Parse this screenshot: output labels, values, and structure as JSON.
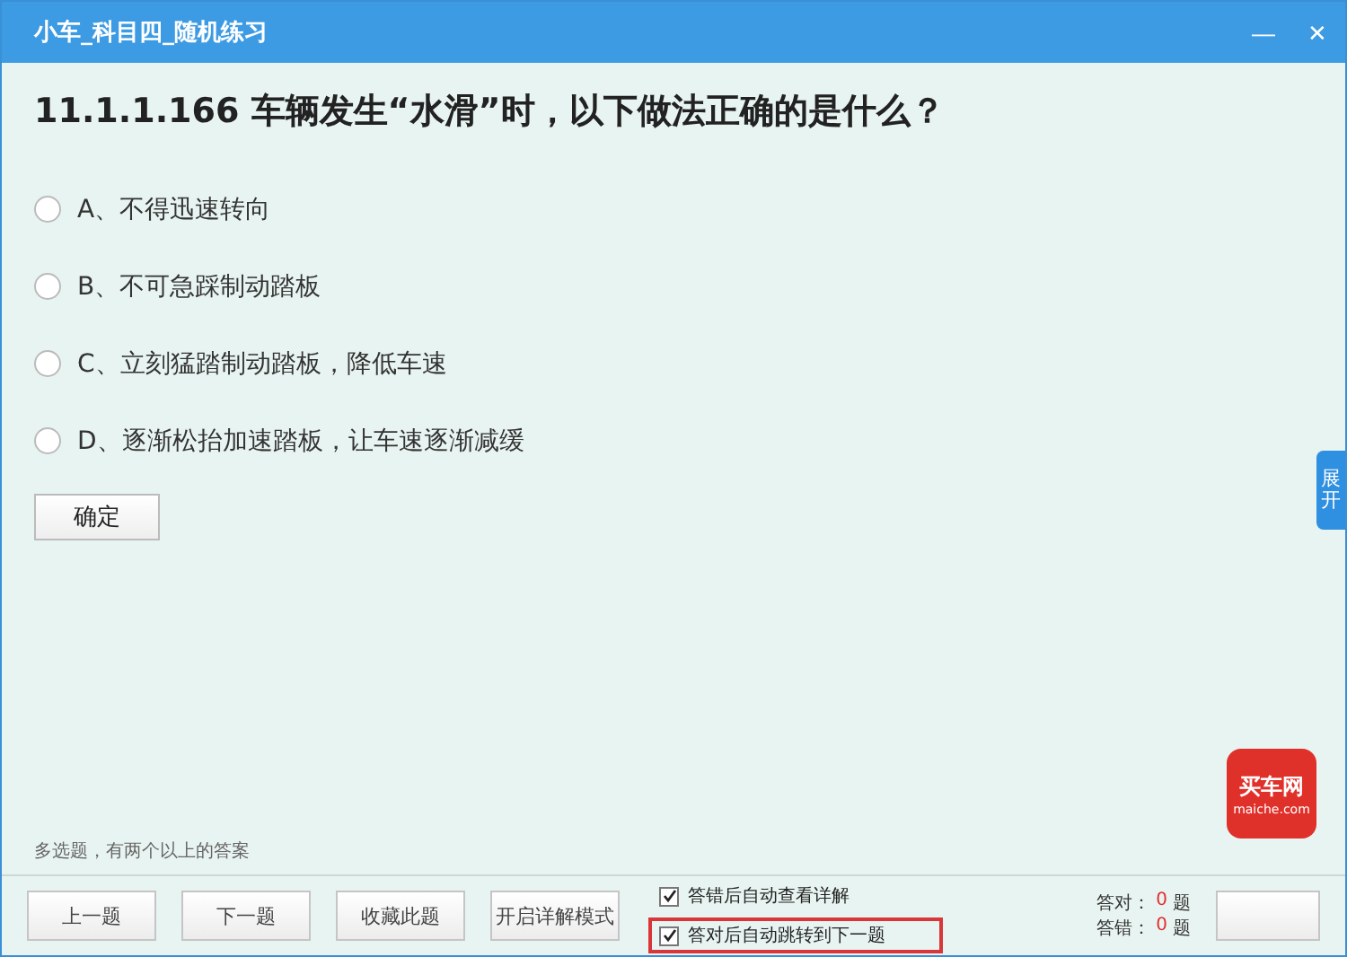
{
  "window": {
    "title": "小车_科目四_随机练习",
    "controls": [
      "—",
      "✕"
    ]
  },
  "question": "11.1.1.166 车辆发生“水滑”时，以下做法正确的是什么？",
  "options": [
    {
      "label": "A、不得迅速转向",
      "selected": false
    },
    {
      "label": "B、不可急踩制动踏板",
      "selected": false
    },
    {
      "label": "C、立刻猛踏制动踏板，降低车速",
      "selected": false
    },
    {
      "label": "D、逐渐松抬加速踏板，让车速逐渐减缓",
      "selected": false
    }
  ],
  "confirm_button": "确定",
  "side_tab": "展开",
  "hint": "多选题，有两个以上的答案",
  "logo": {
    "title": "买车网",
    "url": "maiche.com"
  },
  "footer": {
    "buttons": [
      "上一题",
      "下一题",
      "收藏此题",
      "开启详解模式"
    ],
    "settings": [
      {
        "label": "答错后自动查看详解",
        "checked": true,
        "highlighted": false
      },
      {
        "label": "答对后自动跳转到下一题",
        "checked": true,
        "highlighted": true
      }
    ],
    "stats": [
      {
        "label": "答对：",
        "count": "0",
        "unit": "题"
      },
      {
        "label": "答错：",
        "count": "0",
        "unit": "题"
      }
    ]
  }
}
